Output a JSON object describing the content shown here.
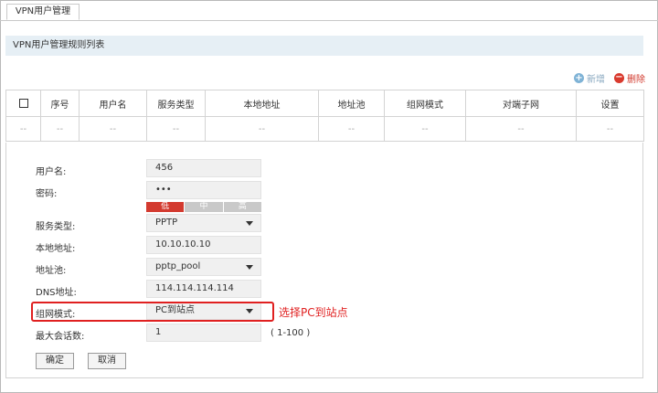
{
  "tab": {
    "label": "VPN用户管理"
  },
  "section": {
    "title": "VPN用户管理规则列表"
  },
  "actions": {
    "add": "新增",
    "delete": "删除"
  },
  "table": {
    "headers": [
      "序号",
      "用户名",
      "服务类型",
      "本地地址",
      "地址池",
      "组网模式",
      "对端子网",
      "设置"
    ],
    "row": [
      "--",
      "--",
      "--",
      "--",
      "--",
      "--",
      "--",
      "--",
      "--"
    ]
  },
  "form": {
    "username_label": "用户名:",
    "username_value": "456",
    "password_label": "密码:",
    "password_value": "•••",
    "strength": {
      "low": "低",
      "mid": "中",
      "high": "高"
    },
    "service_label": "服务类型:",
    "service_value": "PPTP",
    "local_label": "本地地址:",
    "local_value": "10.10.10.10",
    "pool_label": "地址池:",
    "pool_value": "pptp_pool",
    "dns_label": "DNS地址:",
    "dns_value": "114.114.114.114",
    "mode_label": "组网模式:",
    "mode_value": "PC到站点",
    "max_label": "最大会话数:",
    "max_value": "1",
    "max_range": "( 1-100 )",
    "ok": "确定",
    "cancel": "取消"
  },
  "annotation": "选择PC到站点",
  "colors": {
    "accent_red": "#e02020",
    "section_bg": "#e6eff5",
    "add_blue": "#7fb3d6",
    "delete_red": "#d93a2e"
  }
}
